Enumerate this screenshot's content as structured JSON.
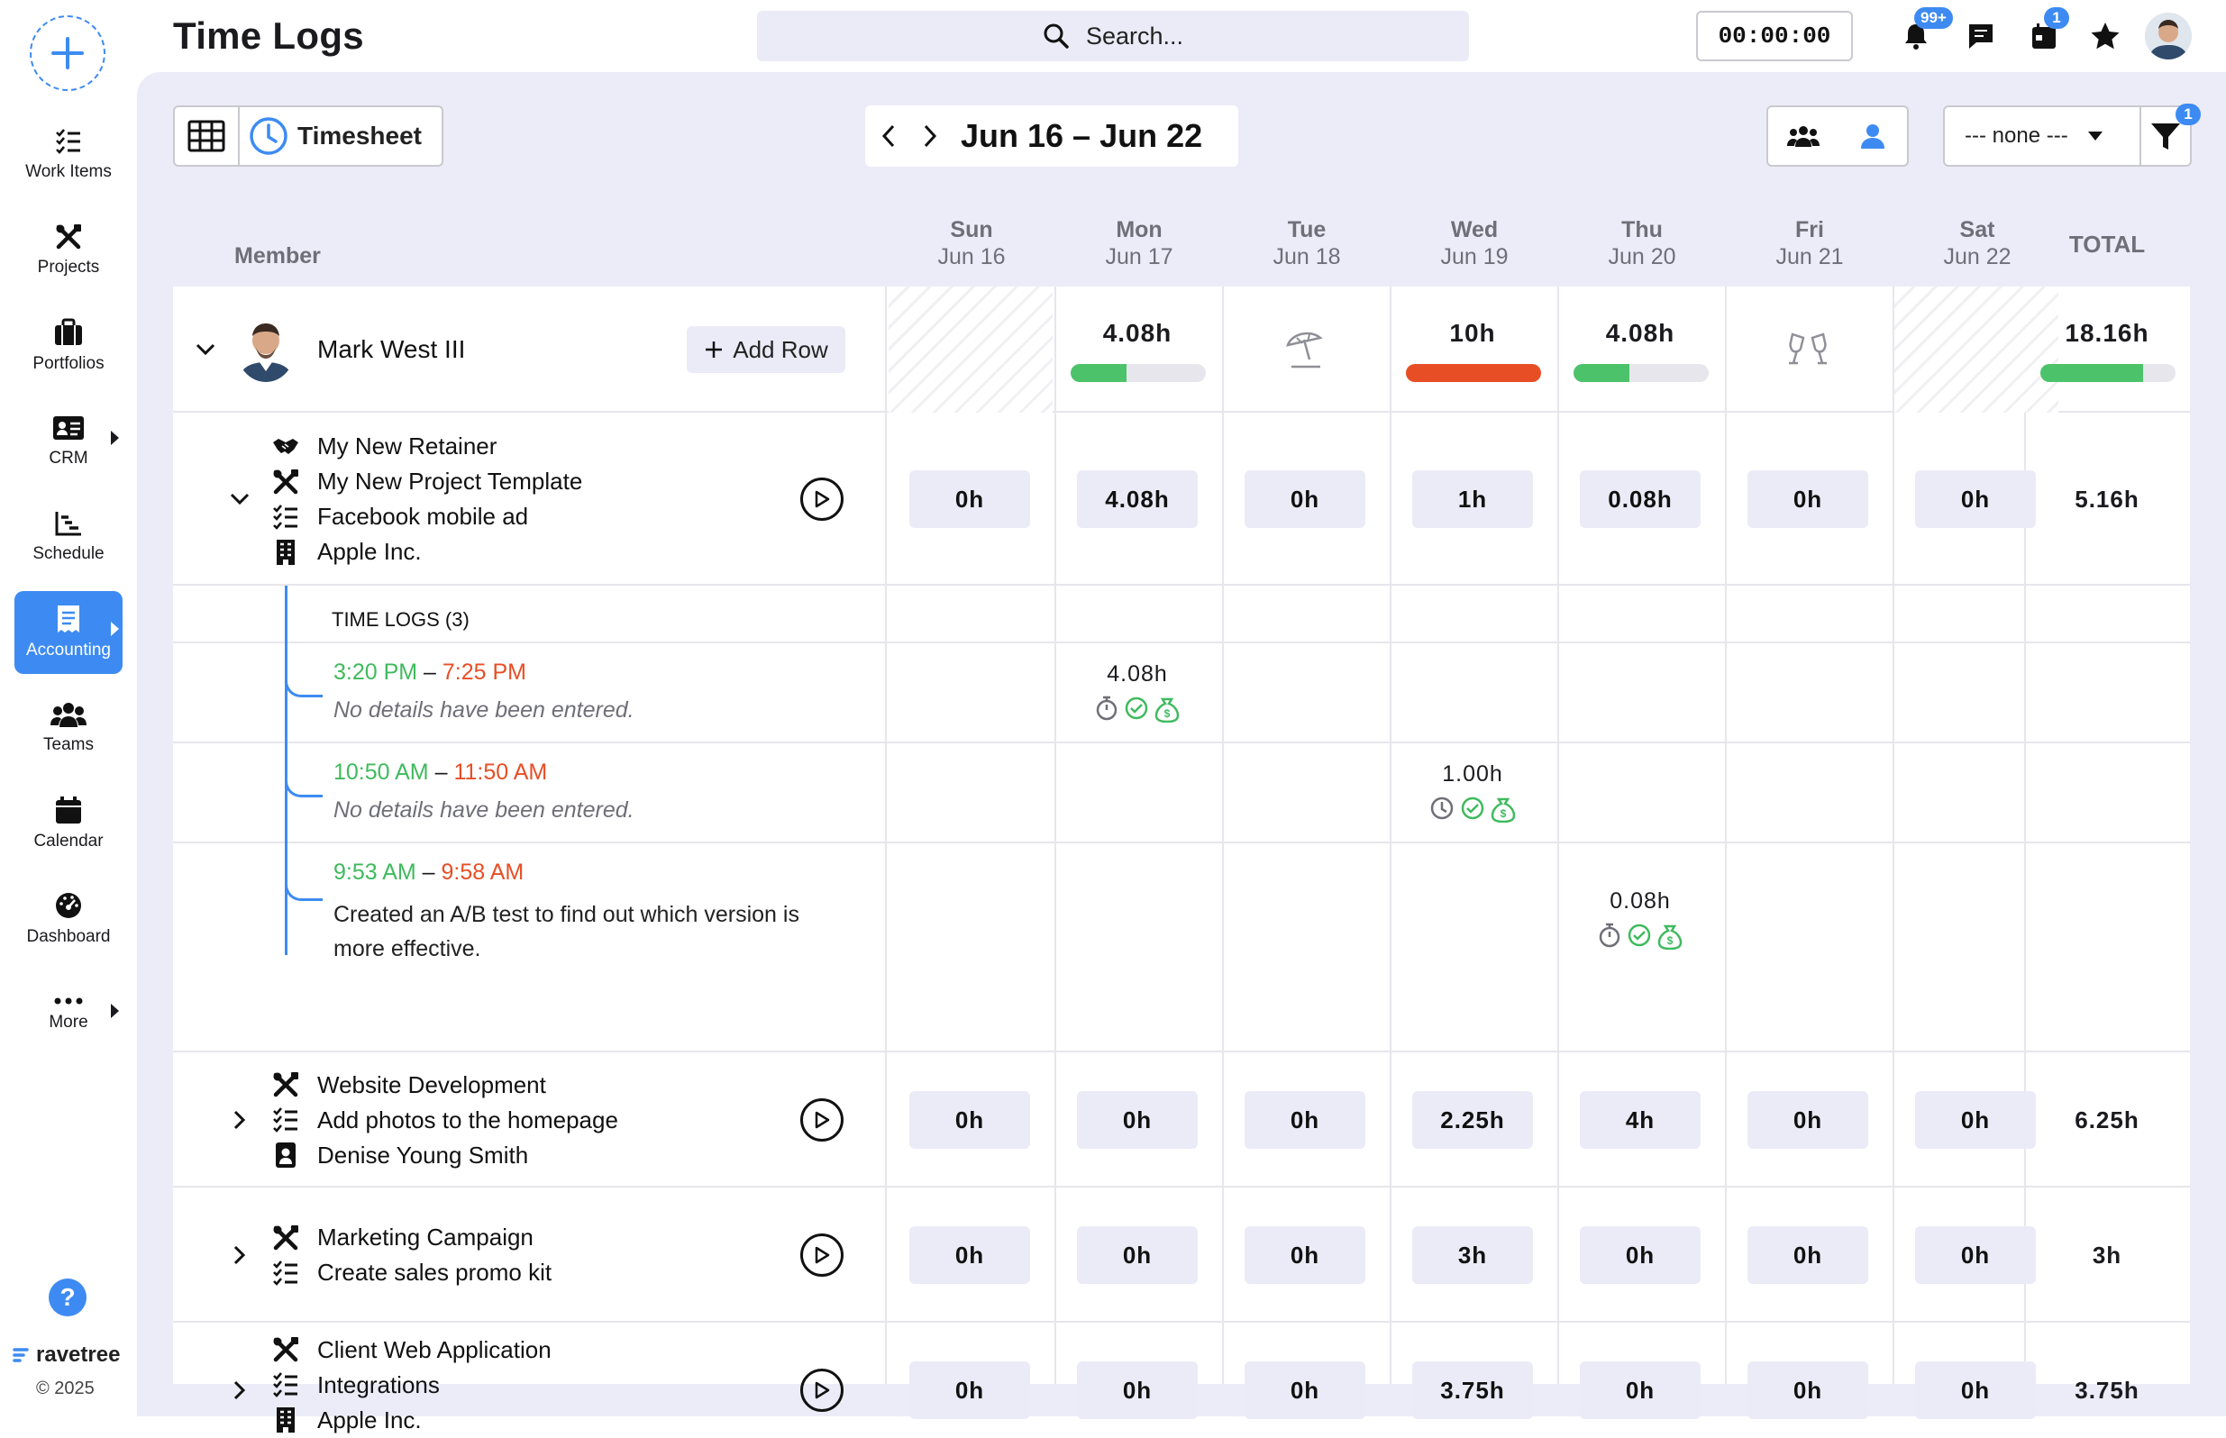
{
  "sidebar": {
    "items": [
      {
        "label": "Work Items",
        "icon": "checklist-icon"
      },
      {
        "label": "Projects",
        "icon": "tools-icon"
      },
      {
        "label": "Portfolios",
        "icon": "briefcase-icon"
      },
      {
        "label": "CRM",
        "icon": "contact-card-icon"
      },
      {
        "label": "Schedule",
        "icon": "gantt-icon"
      },
      {
        "label": "Accounting",
        "icon": "receipt-icon"
      },
      {
        "label": "Teams",
        "icon": "team-icon"
      },
      {
        "label": "Calendar",
        "icon": "calendar-icon"
      },
      {
        "label": "Dashboard",
        "icon": "gauge-icon"
      },
      {
        "label": "More",
        "icon": "more-icon"
      }
    ],
    "active": "Accounting",
    "help": "?",
    "brand": "ravetree",
    "copyright": "© 2025"
  },
  "header": {
    "title": "Time Logs",
    "search_placeholder": "Search...",
    "timer": "00:00:00",
    "notifications_badge": "99+",
    "calendar_badge": "1"
  },
  "toolbar": {
    "view_label": "Timesheet",
    "date_range": "Jun 16 – Jun 22",
    "group_select": "--- none ---",
    "filter_badge": "1"
  },
  "table": {
    "member_header": "Member",
    "total_header": "TOTAL",
    "days": [
      {
        "dow": "Sun",
        "date": "Jun 16"
      },
      {
        "dow": "Mon",
        "date": "Jun 17"
      },
      {
        "dow": "Tue",
        "date": "Jun 18"
      },
      {
        "dow": "Wed",
        "date": "Jun 19"
      },
      {
        "dow": "Thu",
        "date": "Jun 20"
      },
      {
        "dow": "Fri",
        "date": "Jun 21"
      },
      {
        "dow": "Sat",
        "date": "Jun 22"
      }
    ],
    "member": {
      "name": "Mark West III",
      "add_row": "Add Row",
      "day_totals": [
        "",
        "4.08h",
        "",
        "10h",
        "4.08h",
        "",
        ""
      ],
      "day_progress": [
        null,
        0.41,
        null,
        1.0,
        0.41,
        null,
        null
      ],
      "total": "18.16h",
      "total_progress": 0.76
    },
    "rows": [
      {
        "lines": [
          {
            "icon": "handshake-icon",
            "text": "My New Retainer"
          },
          {
            "icon": "tools-icon",
            "text": "My New Project Template"
          },
          {
            "icon": "checklist-icon",
            "text": "Facebook mobile ad"
          },
          {
            "icon": "building-icon",
            "text": "Apple Inc."
          }
        ],
        "values": [
          "0h",
          "4.08h",
          "0h",
          "1h",
          "0.08h",
          "0h",
          "0h"
        ],
        "total": "5.16h"
      },
      {
        "lines": [
          {
            "icon": "tools-icon",
            "text": "Website Development"
          },
          {
            "icon": "checklist-icon",
            "text": "Add photos to the homepage"
          },
          {
            "icon": "contact-icon",
            "text": "Denise Young Smith"
          }
        ],
        "values": [
          "0h",
          "0h",
          "0h",
          "2.25h",
          "4h",
          "0h",
          "0h"
        ],
        "total": "6.25h"
      },
      {
        "lines": [
          {
            "icon": "tools-icon",
            "text": "Marketing Campaign"
          },
          {
            "icon": "checklist-icon",
            "text": "Create sales promo kit"
          }
        ],
        "values": [
          "0h",
          "0h",
          "0h",
          "3h",
          "0h",
          "0h",
          "0h"
        ],
        "total": "3h"
      },
      {
        "lines": [
          {
            "icon": "tools-icon",
            "text": "Client Web Application"
          },
          {
            "icon": "checklist-icon",
            "text": "Integrations"
          },
          {
            "icon": "building-icon",
            "text": "Apple Inc."
          }
        ],
        "values": [
          "0h",
          "0h",
          "0h",
          "3.75h",
          "0h",
          "0h",
          "0h"
        ],
        "total": "3.75h"
      }
    ],
    "time_logs": {
      "header": "TIME LOGS (3)",
      "entries": [
        {
          "start": "3:20 PM",
          "end": "7:25 PM",
          "desc": "No details have been entered.",
          "value": "4.08h",
          "day_index": 1,
          "icons": [
            "stopwatch-icon",
            "check-circle-icon",
            "billable-icon"
          ]
        },
        {
          "start": "10:50 AM",
          "end": "11:50 AM",
          "desc": "No details have been entered.",
          "value": "1.00h",
          "day_index": 3,
          "icons": [
            "clock-icon",
            "check-circle-icon",
            "billable-icon"
          ]
        },
        {
          "start": "9:53 AM",
          "end": "9:58 AM",
          "desc": "Created an A/B test to find out which version is more effective.",
          "value": "0.08h",
          "day_index": 4,
          "icons": [
            "stopwatch-icon",
            "check-circle-icon",
            "billable-icon"
          ]
        }
      ]
    }
  },
  "colors": {
    "accent": "#3d8bf2",
    "start_time": "#3fba5e",
    "end_time": "#e84e25",
    "progress_ok": "#4cc36a",
    "progress_full": "#e84e25"
  }
}
